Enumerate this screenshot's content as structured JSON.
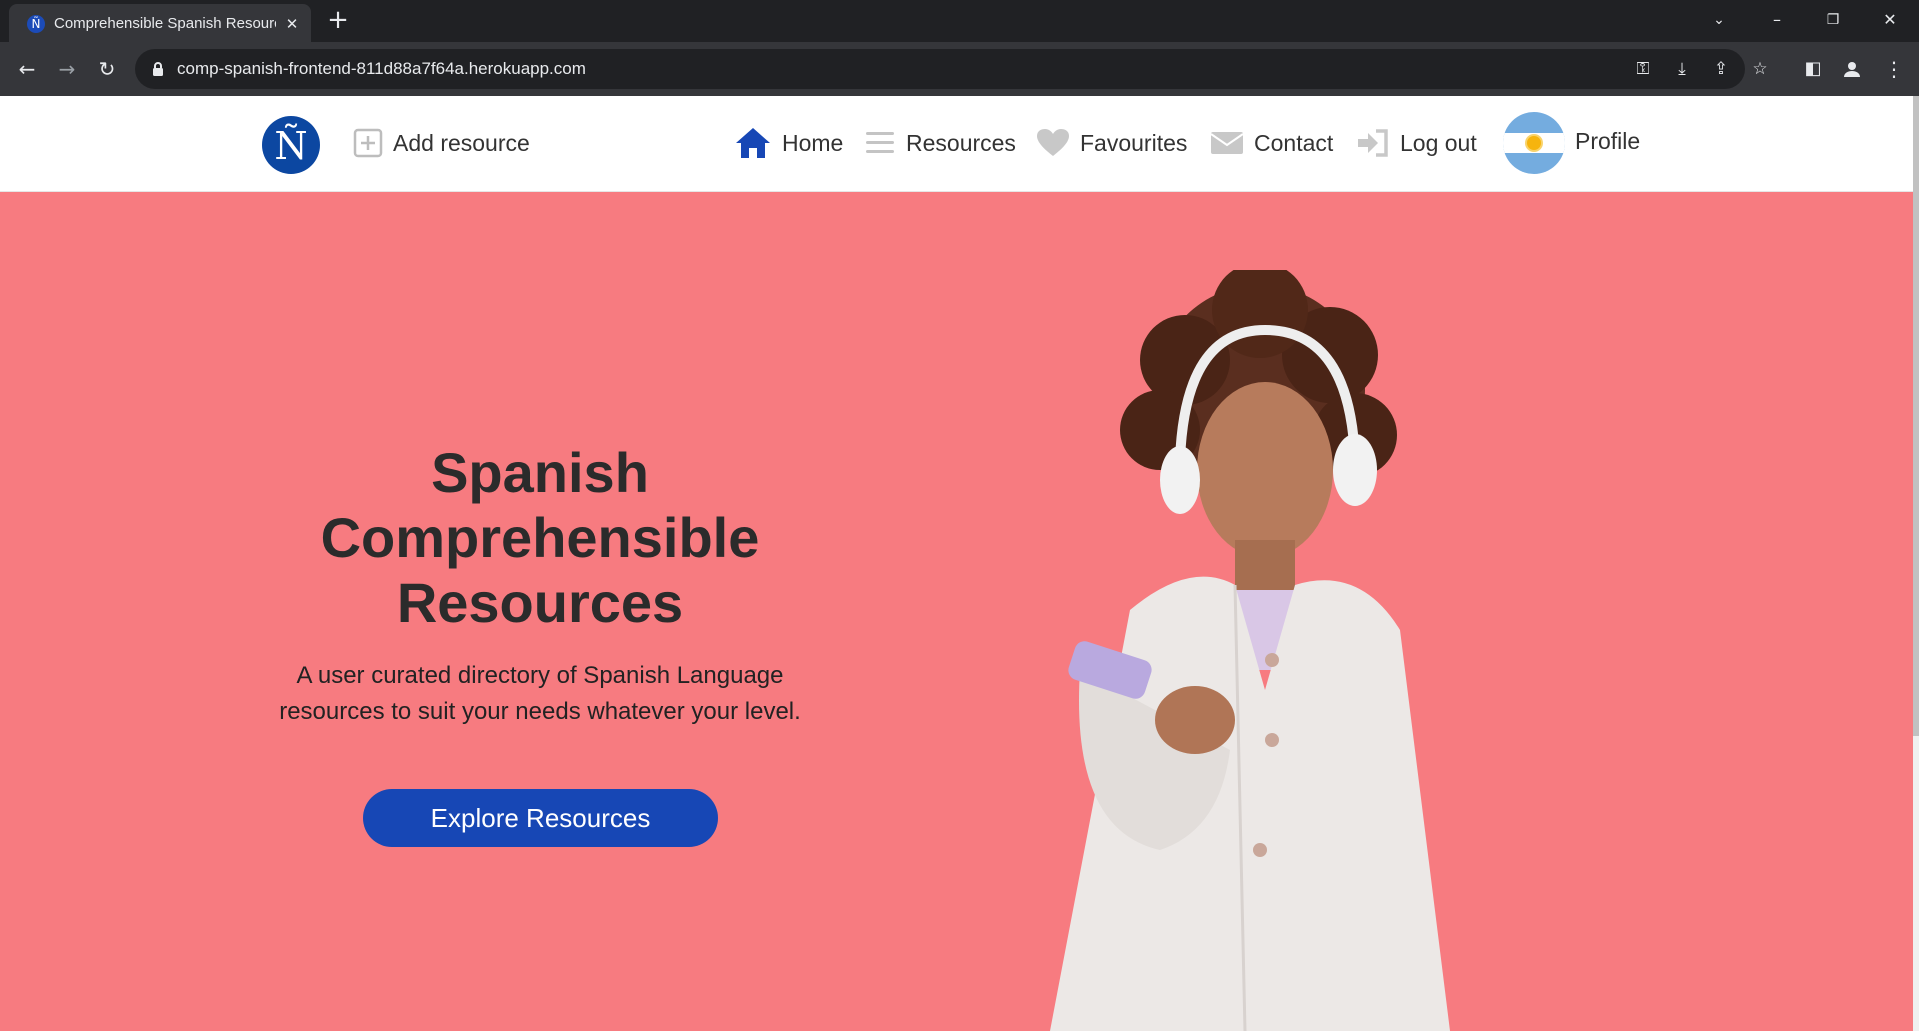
{
  "browser": {
    "tab_title": "Comprehensible Spanish Resources",
    "tab_favicon": "Ñ",
    "url": "comp-spanish-frontend-811d88a7f64a.herokuapp.com"
  },
  "navbar": {
    "logo_letter": "Ñ",
    "add_resource": "Add resource",
    "home": "Home",
    "resources": "Resources",
    "favourites": "Favourites",
    "contact": "Contact",
    "logout": "Log out",
    "profile": "Profile"
  },
  "hero": {
    "title_line1": "Spanish",
    "title_line2": "Comprehensible",
    "title_line3": "Resources",
    "subtitle": "A user curated directory of Spanish Language resources to suit your needs whatever your level.",
    "button": "Explore Resources"
  },
  "icons": {
    "tab_favicon": "n-tilde-logo-icon",
    "home": "home-icon",
    "resources": "list-icon",
    "favourites": "heart-icon",
    "contact": "envelope-icon",
    "logout": "sign-out-icon",
    "add_resource": "plus-square-icon",
    "profile": "argentina-flag-avatar"
  },
  "colors": {
    "hero_background": "#f77b80",
    "brand_blue": "#1747b5",
    "navbar_background": "#ffffff",
    "chrome_dark": "#202124"
  }
}
